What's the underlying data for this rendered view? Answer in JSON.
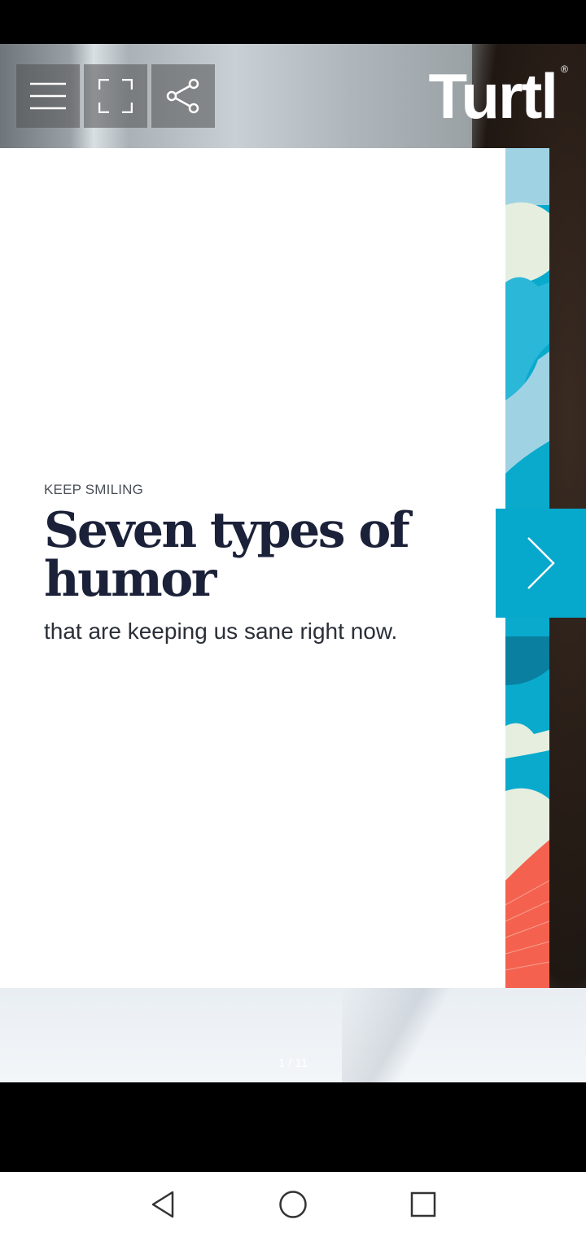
{
  "brand": {
    "name": "Turtl",
    "registered": "®"
  },
  "toolbar": {
    "menu_icon": "hamburger-menu-icon",
    "fullscreen_icon": "fullscreen-icon",
    "share_icon": "share-icon"
  },
  "page": {
    "kicker": "KEEP SMILING",
    "headline": "Seven types of humor",
    "subtitle": "that are keeping us sane right now.",
    "counter": "1 / 11"
  },
  "next_button": {
    "icon": "chevron-right-icon"
  },
  "system_nav": {
    "back": "back-icon",
    "home": "home-icon",
    "recents": "recents-icon"
  },
  "colors": {
    "accent": "#06a8cc",
    "headline": "#1b2138",
    "art_coral": "#f4624f",
    "art_light": "#e8efe4"
  }
}
